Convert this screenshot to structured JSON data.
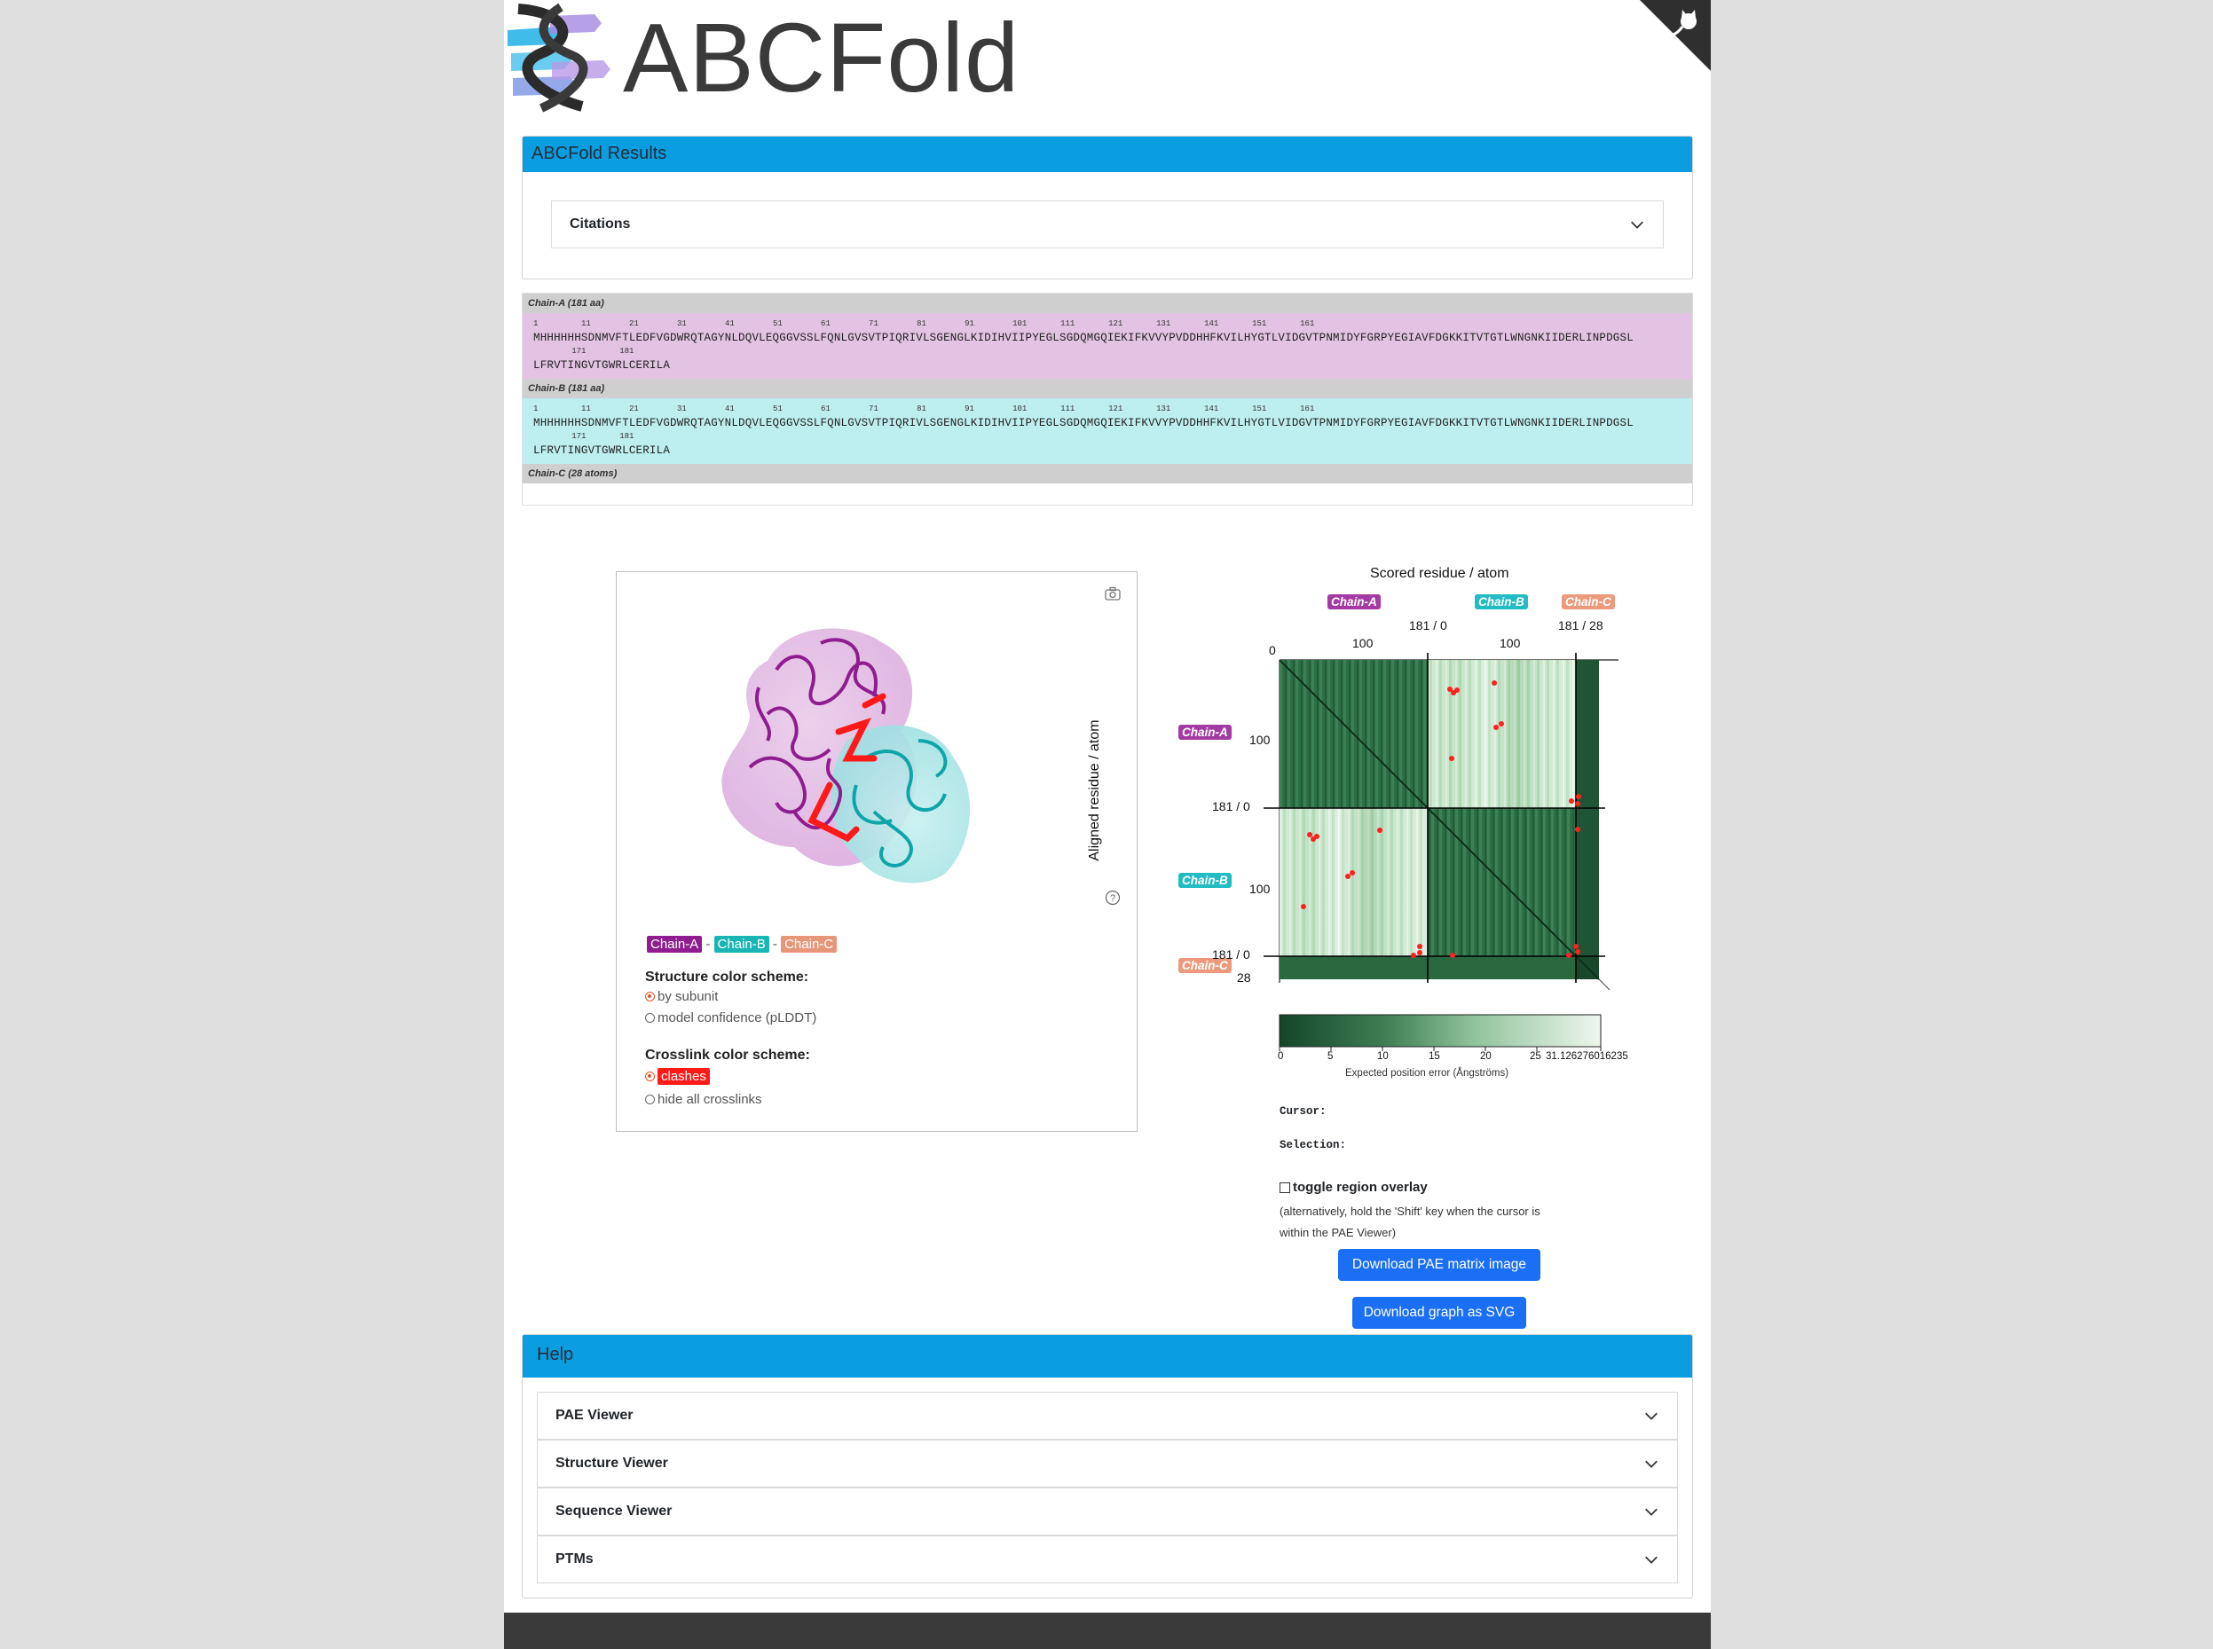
{
  "app": {
    "brand": "ABCFold",
    "corner_icon": "github-cat-icon",
    "logo_icon": "abcfold-helix-logo"
  },
  "results": {
    "title": "ABCFold Results",
    "citations_label": "Citations"
  },
  "sequences": [
    {
      "header": "Chain-A (181 aa)",
      "ticks_line1": "1         11        21        31        41        51        61        71        81        91        101       111       121       131       141       151       161",
      "residues_line1": "MHHHHHHSDNMVFTLEDFVGDWRQTAGYNLDQVLEQGGVSSLFQNLGVSVTPIQRIVLSGENGLKIDIHVIIPYEGLSGDQMGQIEKIFKVVYPVDDHHFKVILHYGTLVIDGVTPNMIDYFGRPYEGIAVFDGKKITVTGTLWNGNKIIDERLINPDGSL",
      "ticks_line2": "        171       181",
      "residues_line2": "LFRVTINGVTGWRLCERILA"
    },
    {
      "header": "Chain-B (181 aa)",
      "ticks_line1": "1         11        21        31        41        51        61        71        81        91        101       111       121       131       141       151       161",
      "residues_line1": "MHHHHHHSDNMVFTLEDFVGDWRQTAGYNLDQVLEQGGVSSLFQNLGVSVTPIQRIVLSGENGLKIDIHVIIPYEGLSGDQMGQIEKIFKVVYPVDDHHFKVILHYGTLVIDGVTPNMIDYFGRPYEGIAVFDGKKITVTGTLWNGNKIIDERLINPDGSL",
      "ticks_line2": "        171       181",
      "residues_line2": "LFRVTINGVTGWRLCERILA"
    },
    {
      "header": "Chain-C (28 atoms)"
    }
  ],
  "structure_viewer": {
    "camera_icon": "camera-icon",
    "help_icon": "question-circle-icon",
    "chains": [
      {
        "label": "Chain-A",
        "color": "#8f1d8f"
      },
      {
        "label": "Chain-B",
        "color": "#19b5b5"
      },
      {
        "label": "Chain-C",
        "color": "#e8967a"
      }
    ],
    "separator": "-",
    "structure_scheme_label": "Structure color scheme:",
    "structure_options": [
      "by subunit",
      "model confidence (pLDDT)"
    ],
    "structure_selected": "by subunit",
    "crosslink_scheme_label": "Crosslink color scheme:",
    "crosslink_options": [
      "clashes",
      "hide all crosslinks"
    ],
    "crosslink_selected": "clashes",
    "clash_color": "#ff1a1a"
  },
  "pae_viewer": {
    "top_title": "Scored residue / atom",
    "left_title": "Aligned residue / atom",
    "chain_tags": [
      {
        "label": "Chain-A",
        "color": "#a43aa4"
      },
      {
        "label": "Chain-B",
        "color": "#22bcc2"
      },
      {
        "label": "Chain-C",
        "color": "#eb9a7b"
      }
    ],
    "top_ticks": [
      "0",
      "100",
      "181 / 0",
      "100",
      "181 / 28"
    ],
    "left_ticks": [
      "100",
      "181 / 0",
      "100",
      "181 / 0",
      "28"
    ],
    "colorbar_ticks": [
      "0",
      "5",
      "10",
      "15",
      "20",
      "25",
      "31.126276016235"
    ],
    "colorbar_label": "Expected position error (Ångströms)",
    "colorbar_max": "31.126276016235",
    "cursor_label": "Cursor:",
    "selection_label": "Selection:",
    "overlay_label": "toggle region overlay",
    "overlay_hint_1": "(alternatively, hold the 'Shift' key when the cursor is",
    "overlay_hint_2": "within the PAE Viewer)",
    "download_png": "Download PAE matrix image",
    "download_svg": "Download graph as SVG",
    "colors": {
      "dark": "#14452a",
      "light": "#e9f5e9",
      "crosslink": "#ff2020"
    }
  },
  "help": {
    "title": "Help",
    "items": [
      "PAE Viewer",
      "Structure Viewer",
      "Sequence Viewer",
      "PTMs"
    ]
  }
}
